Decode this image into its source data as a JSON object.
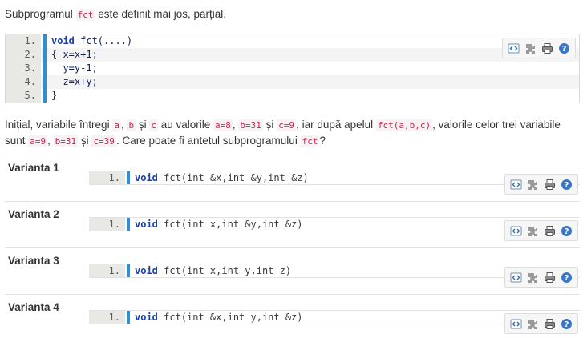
{
  "intro": {
    "before": "Subprogramul ",
    "code": "fct",
    "after": " este definit mai jos, parțial."
  },
  "code_block": {
    "lines": [
      {
        "num": "1.",
        "kw": "void",
        "rest": " fct(....)"
      },
      {
        "num": "2.",
        "kw": "",
        "rest": "{ x=x+1;"
      },
      {
        "num": "3.",
        "kw": "",
        "rest": "  y=y-1;"
      },
      {
        "num": "4.",
        "kw": "",
        "rest": "  z=x+y;"
      },
      {
        "num": "5.",
        "kw": "",
        "rest": "}"
      }
    ]
  },
  "question": {
    "p1": "Inițial, variabile întregi ",
    "a": "a",
    "sep1": ", ",
    "b": "b",
    "and1": " și ",
    "c": "c",
    "p2": " au valorile ",
    "a8": "a=8",
    "sep2": ", ",
    "b31": "b=31",
    "and2": " și ",
    "c9": "c=9",
    "p3": ", iar după apelul ",
    "call": "fct(a,b,c)",
    "p4": ", valorile celor trei variabile sunt ",
    "a9": "a=9",
    "sep3": ", ",
    "b31b": "b=31",
    "and3": " și ",
    "c39": "c=39",
    "p5": ". Care poate fi antetul subprogramului ",
    "fct": "fct",
    "p6": "?"
  },
  "toolbar_icons": [
    "view-source-icon",
    "copy-icon",
    "print-icon",
    "help-icon"
  ],
  "options": [
    {
      "label": "Varianta 1",
      "num": "1.",
      "kw": "void",
      "tail": " fct(int &x,int &y,int &z)"
    },
    {
      "label": "Varianta 2",
      "num": "1.",
      "kw": "void",
      "tail": " fct(int x,int &y,int &z)"
    },
    {
      "label": "Varianta 3",
      "num": "1.",
      "kw": "void",
      "tail": " fct(int x,int y,int z)"
    },
    {
      "label": "Varianta 4",
      "num": "1.",
      "kw": "void",
      "tail": " fct(int &x,int y,int &z)"
    }
  ],
  "colors": {
    "gutter_bar": "#2d8fd5",
    "inline_code": "#c7254e",
    "keyword": "#1b3fa5"
  }
}
